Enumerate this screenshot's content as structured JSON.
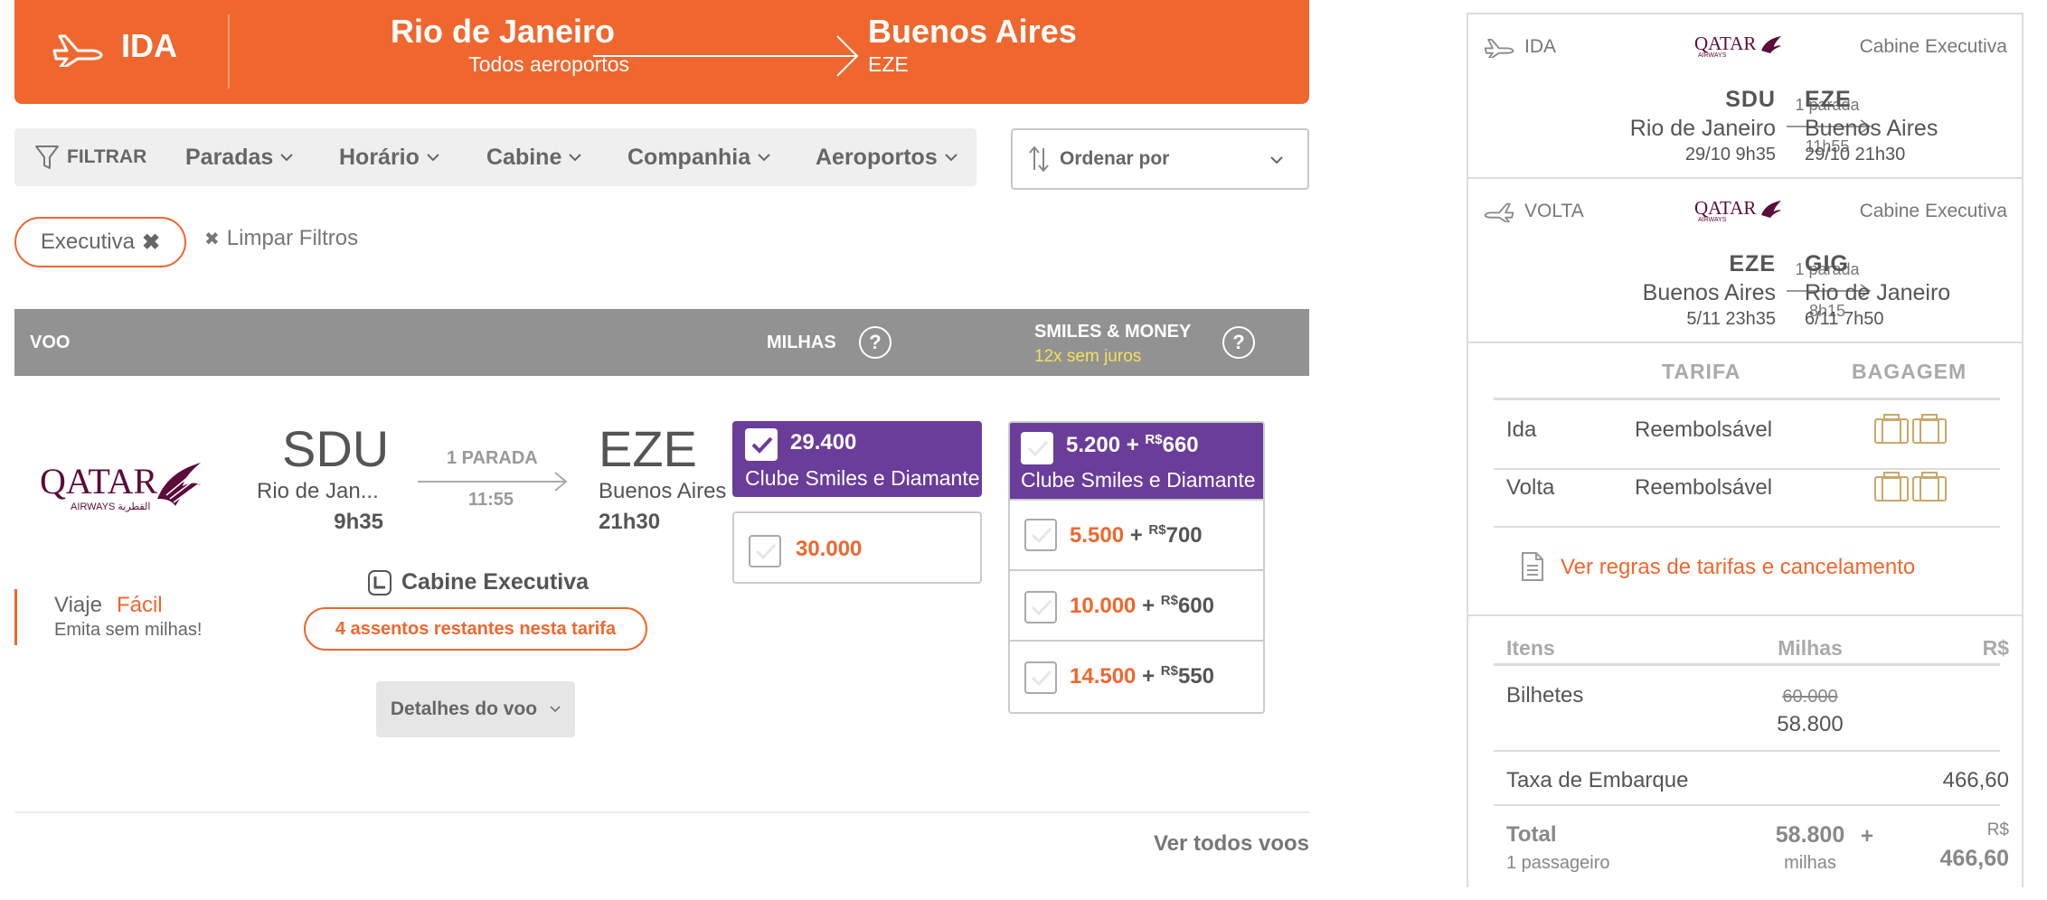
{
  "colors": {
    "accent": "#ef672e",
    "purple": "#6a3d9a",
    "gray_header": "#929292",
    "yellow_note": "#f5e05a"
  },
  "header": {
    "direction_label": "IDA",
    "from_city": "Rio de Janeiro",
    "from_sub": "Todos aeroportos",
    "to_city": "Buenos Aires",
    "to_sub": "EZE",
    "icon": "plane-departure-icon"
  },
  "filters": {
    "filter_label": "FILTRAR",
    "items": [
      "Paradas",
      "Horário",
      "Cabine",
      "Companhia",
      "Aeroportos"
    ],
    "sort_label": "Ordenar por"
  },
  "chips": {
    "active": "Executiva",
    "clear": "Limpar Filtros"
  },
  "results_header": {
    "col_flight": "VOO",
    "col_miles": "MILHAS",
    "col_money": "SMILES & MONEY",
    "col_money_note": "12x sem juros",
    "help": "?"
  },
  "flight": {
    "airline": "Qatar Airways",
    "logo_text": "QATAR",
    "logo_sub": "AIRWAYS القطرية",
    "origin_code": "SDU",
    "origin_city": "Rio de Jan...",
    "origin_time": "9h35",
    "stops": "1 PARADA",
    "duration": "11:55",
    "dest_code": "EZE",
    "dest_city": "Buenos Aires",
    "dest_time": "21h30",
    "promo_brand_a": "Viaje",
    "promo_brand_b": "Fácil",
    "promo_text": "Emita sem milhas!",
    "cabin": "Cabine Executiva",
    "seats_left": "4 assentos restantes nesta tarifa",
    "details_button": "Detalhes do voo",
    "miles_options": [
      {
        "value": "29.400",
        "sub": "Clube Smiles e Diamante",
        "selected": true
      },
      {
        "value": "30.000",
        "selected": false
      }
    ],
    "money_options": [
      {
        "miles": "5.200",
        "plus": "+",
        "rs": "R$",
        "money": "660",
        "sub": "Clube Smiles e Diamante",
        "selected": false
      },
      {
        "miles": "5.500",
        "plus": "+",
        "rs": "R$",
        "money": "700"
      },
      {
        "miles": "10.000",
        "plus": "+",
        "rs": "R$",
        "money": "600"
      },
      {
        "miles": "14.500",
        "plus": "+",
        "rs": "R$",
        "money": "550"
      }
    ]
  },
  "see_all": "Ver todos voos",
  "summary": {
    "outbound": {
      "label": "IDA",
      "airline_logo": "QATAR",
      "airline_sub": "AIRWAYS",
      "cabin": "Cabine Executiva",
      "from_code": "SDU",
      "from_city": "Rio de Janeiro",
      "from_dt": "29/10 9h35",
      "stops": "1 parada",
      "duration": "11h55",
      "to_code": "EZE",
      "to_city": "Buenos Aires",
      "to_dt": "29/10 21h30"
    },
    "inbound": {
      "label": "VOLTA",
      "airline_logo": "QATAR",
      "airline_sub": "AIRWAYS",
      "cabin": "Cabine Executiva",
      "from_code": "EZE",
      "from_city": "Buenos Aires",
      "from_dt": "5/11 23h35",
      "stops": "1 parada",
      "duration": "8h15",
      "to_code": "GIG",
      "to_city": "Rio de Janeiro",
      "to_dt": "6/11 7h50"
    },
    "fare_table": {
      "col_fare": "TARIFA",
      "col_bag": "BAGAGEM",
      "rows": [
        {
          "leg": "Ida",
          "fare": "Reembolsável",
          "bags": 2
        },
        {
          "leg": "Volta",
          "fare": "Reembolsável",
          "bags": 2
        }
      ]
    },
    "rules_link": "Ver regras de tarifas e cancelamento",
    "price": {
      "col_items": "Itens",
      "col_miles": "Milhas",
      "col_rs": "R$",
      "tickets_label": "Bilhetes",
      "tickets_old": "60.000",
      "tickets_new": "58.800",
      "tax_label": "Taxa de Embarque",
      "tax_value": "466,60",
      "total_label": "Total",
      "total_sub": "1 passageiro",
      "total_miles": "58.800",
      "total_miles_unit": "milhas",
      "total_plus": "+",
      "total_rs": "R$",
      "total_money": "466,60"
    }
  }
}
